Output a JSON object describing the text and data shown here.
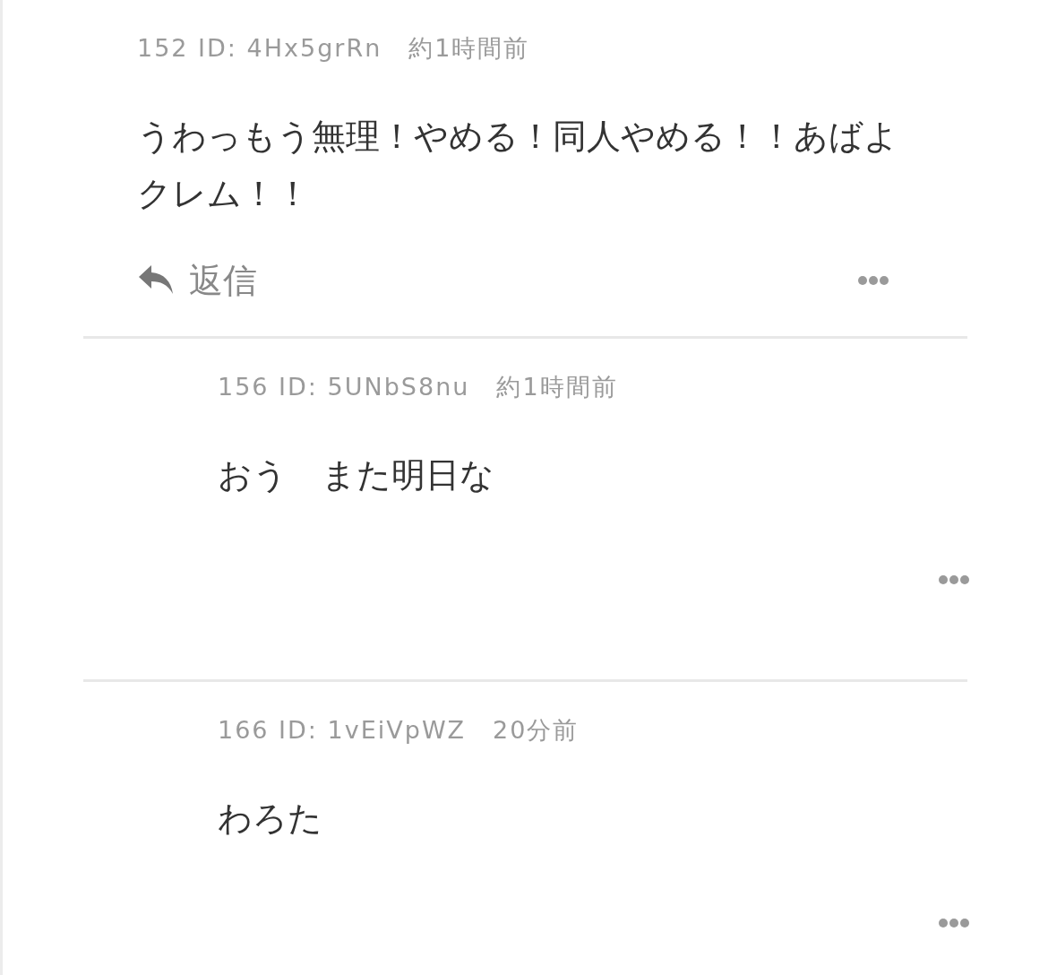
{
  "posts": [
    {
      "kind": "top",
      "number": "152 ID: 4Hx5grRn",
      "time": "約1時間前",
      "body": "うわっもう無理！やめる！同人やめる！！あばよクレム！！",
      "reply_label": "返信"
    },
    {
      "kind": "nested",
      "number": "156 ID: 5UNbS8nu",
      "time": "約1時間前",
      "body": "おう　また明日な"
    },
    {
      "kind": "nested",
      "number": "166 ID: 1vEiVpWZ",
      "time": "20分前",
      "body": "わろた"
    }
  ]
}
